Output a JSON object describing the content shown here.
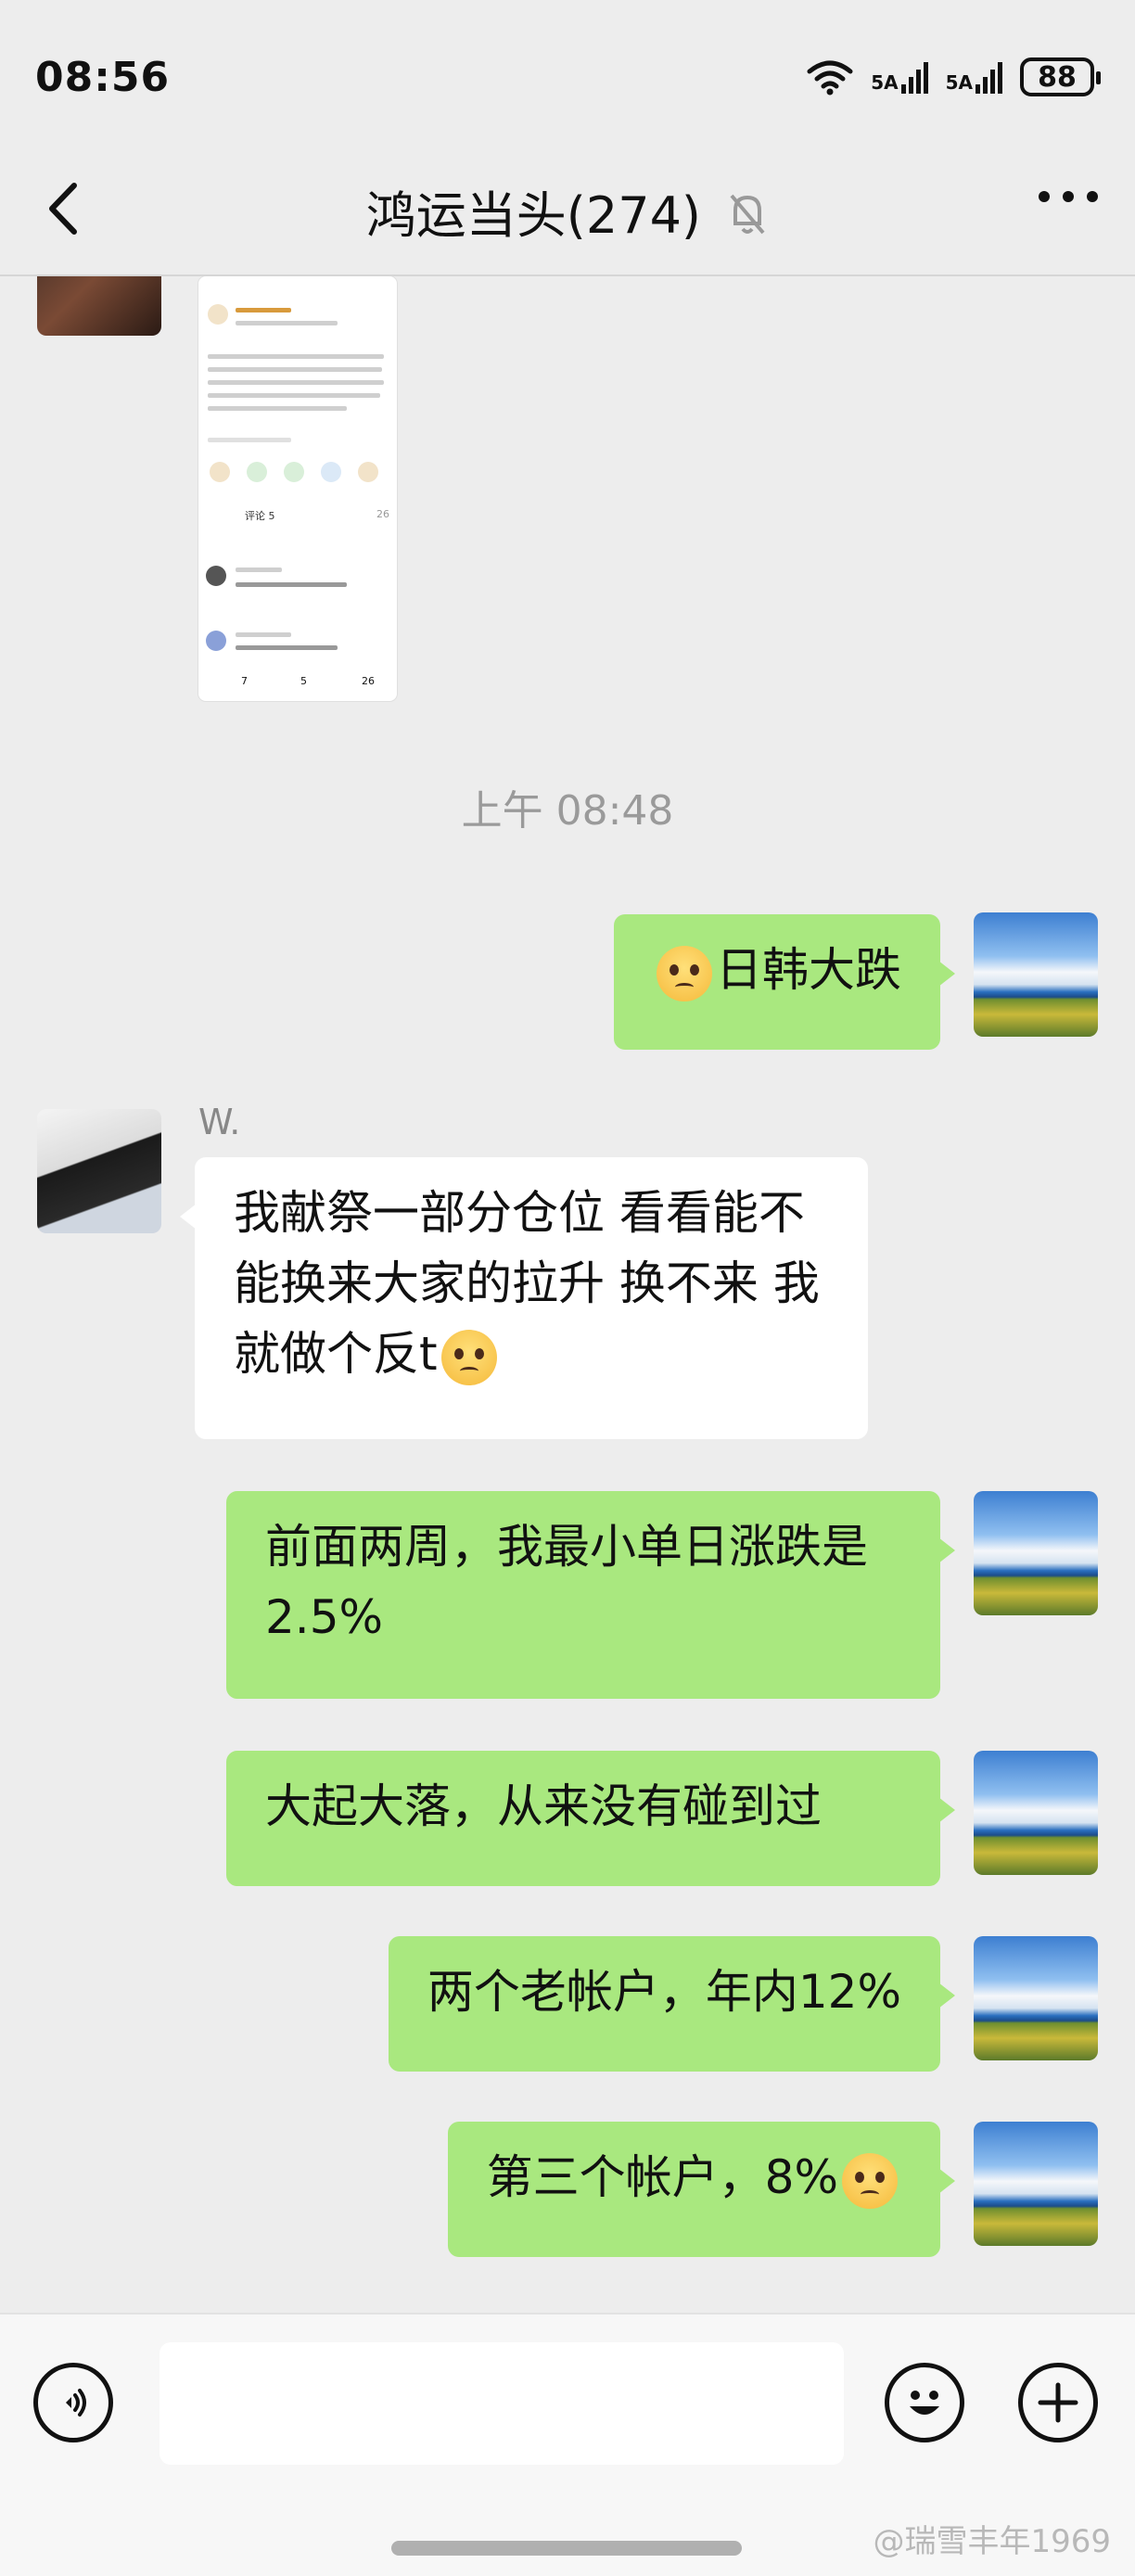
{
  "status_bar": {
    "time": "08:56",
    "network_1": "5A",
    "network_2": "5A",
    "battery": "88"
  },
  "header": {
    "title": "鸿运当头(274)"
  },
  "chat": {
    "timestamp": "上午 08:48",
    "messages": [
      {
        "side": "right",
        "text": "日韩大跌",
        "emoji_before": true
      },
      {
        "side": "left",
        "sender": "W.",
        "text": "我献祭一部分仓位 看看能不能换来大家的拉升 换不来 我就做个反t"
      },
      {
        "side": "right",
        "text": "前面两周，我最小单日涨跌是2.5%"
      },
      {
        "side": "right",
        "text": "大起大落，从来没有碰到过"
      },
      {
        "side": "right",
        "text": "两个老帐户，年内12%"
      },
      {
        "side": "right",
        "text": "第三个帐户，8%",
        "emoji_after": true
      }
    ],
    "shared_screenshot": {
      "comments_tab": "评论 5",
      "likes": "26",
      "reposts": "7",
      "comment_count": "5"
    }
  },
  "input_bar": {
    "voice_icon": "voice-icon",
    "emoji_icon": "emoji-icon",
    "plus_icon": "plus-icon"
  },
  "watermark": "@瑞雪丰年1969"
}
